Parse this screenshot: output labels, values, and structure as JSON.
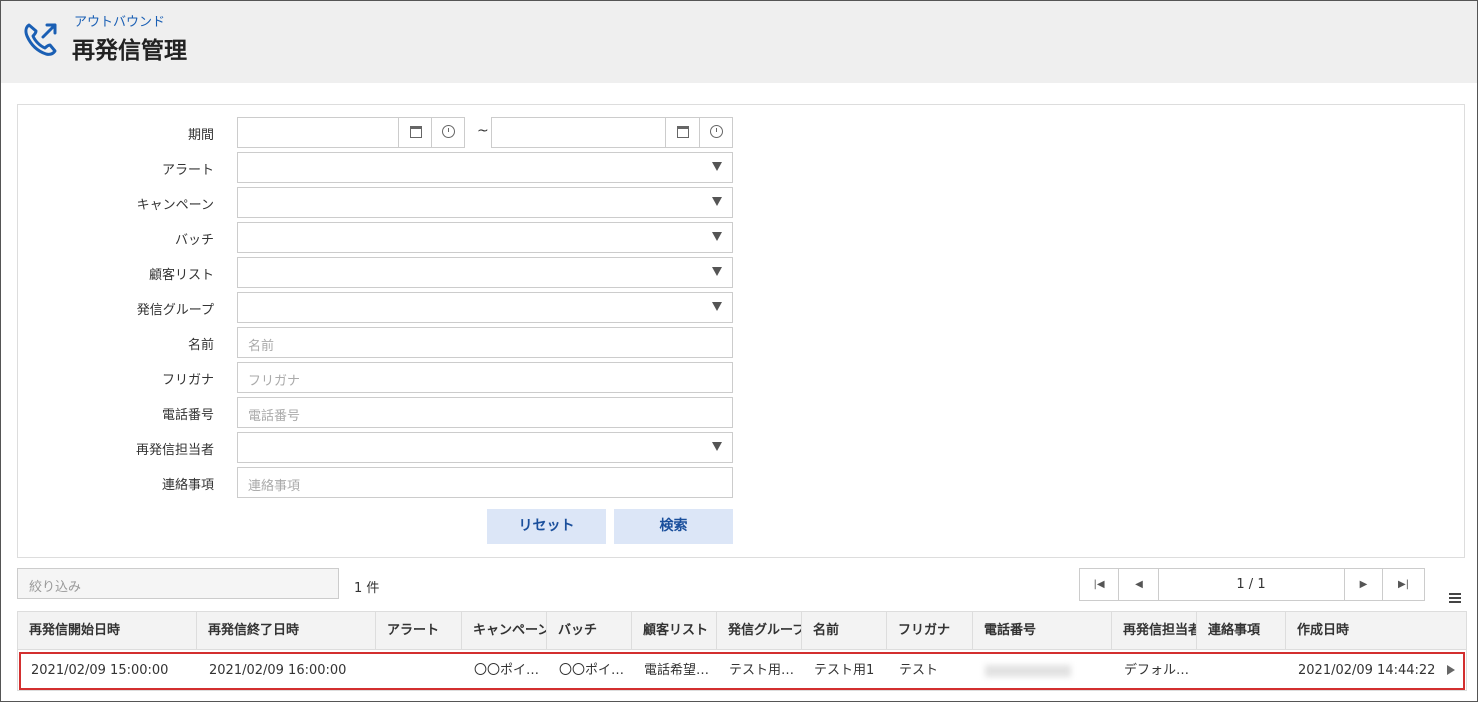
{
  "header": {
    "subtitle": "アウトバウンド",
    "title": "再発信管理"
  },
  "form": {
    "period_label": "期間",
    "tilde": "~",
    "alert_label": "アラート",
    "campaign_label": "キャンペーン",
    "batch_label": "バッチ",
    "customer_list_label": "顧客リスト",
    "call_group_label": "発信グループ",
    "name_label": "名前",
    "name_placeholder": "名前",
    "furigana_label": "フリガナ",
    "furigana_placeholder": "フリガナ",
    "phone_label": "電話番号",
    "phone_placeholder": "電話番号",
    "redial_owner_label": "再発信担当者",
    "notes_label": "連絡事項",
    "notes_placeholder": "連絡事項",
    "reset_button": "リセット",
    "search_button": "検索"
  },
  "list": {
    "filter_placeholder": "絞り込み",
    "count": "1 件",
    "pager_text": "1 / 1",
    "columns": [
      "再発信開始日時",
      "再発信終了日時",
      "アラート",
      "キャンペーン",
      "バッチ",
      "顧客リスト",
      "発信グループ",
      "名前",
      "フリガナ",
      "電話番号",
      "再発信担当者",
      "連絡事項",
      "作成日時"
    ],
    "rows": [
      {
        "start": "2021/02/09 15:00:00",
        "end": "2021/02/09 16:00:00",
        "alert": "",
        "campaign": "〇〇ポイ…",
        "batch": "〇〇ポイ…",
        "customer_list": "電話希望…",
        "call_group": "テスト用…",
        "name": "テスト用1",
        "furigana": "テスト",
        "owner": "デフォル…",
        "notes": "",
        "created": "2021/02/09 14:44:22"
      }
    ]
  }
}
